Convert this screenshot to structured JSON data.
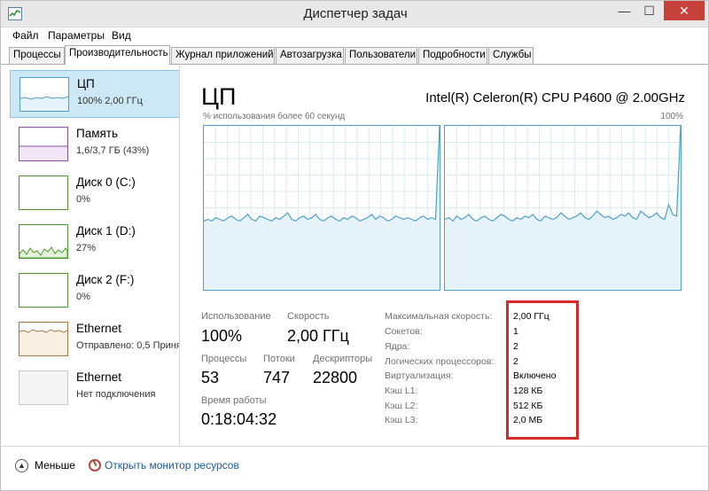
{
  "window": {
    "title": "Диспетчер задач",
    "controls": {
      "minimize": "—",
      "maximize": "☐",
      "close": "✕"
    }
  },
  "menu": [
    "Файл",
    "Параметры",
    "Вид"
  ],
  "tabs": [
    {
      "label": "Процессы",
      "active": false
    },
    {
      "label": "Производительность",
      "active": true
    },
    {
      "label": "Журнал приложений",
      "active": false
    },
    {
      "label": "Автозагрузка",
      "active": false
    },
    {
      "label": "Пользователи",
      "active": false
    },
    {
      "label": "Подробности",
      "active": false
    },
    {
      "label": "Службы",
      "active": false
    }
  ],
  "resources": [
    {
      "name": "ЦП",
      "detail": "100% 2,00 ГГц",
      "selected": true
    },
    {
      "name": "Память",
      "detail": "1,6/3,7 ГБ (43%)"
    },
    {
      "name": "Диск 0 (C:)",
      "detail": "0%"
    },
    {
      "name": "Диск 1 (D:)",
      "detail": "27%"
    },
    {
      "name": "Диск 2 (F:)",
      "detail": "0%"
    },
    {
      "name": "Ethernet",
      "detail": "Отправлено: 0,5 Приня"
    },
    {
      "name": "Ethernet",
      "detail": "Нет подключения"
    }
  ],
  "cpu": {
    "title": "ЦП",
    "model": "Intel(R) Celeron(R) CPU P4600 @ 2.00GHz",
    "graph_label": "% использования более 60 секунд",
    "graph_max": "100%",
    "stats": {
      "usage_label": "Использование",
      "usage_value": "100%",
      "speed_label": "Скорость",
      "speed_value": "2,00 ГГц",
      "processes_label": "Процессы",
      "processes_value": "53",
      "threads_label": "Потоки",
      "threads_value": "747",
      "handles_label": "Дескрипторы",
      "handles_value": "22800",
      "uptime_label": "Время работы",
      "uptime_value": "0:18:04:32"
    },
    "specs": [
      {
        "label": "Максимальная скорость:",
        "value": "2,00 ГГц"
      },
      {
        "label": "Сокетов:",
        "value": "1"
      },
      {
        "label": "Ядра:",
        "value": "2"
      },
      {
        "label": "Логических процессоров:",
        "value": "2"
      },
      {
        "label": "Виртуализация:",
        "value": "Включено"
      },
      {
        "label": "Кэш L1:",
        "value": "128 КБ"
      },
      {
        "label": "Кэш L2:",
        "value": "512 КБ"
      },
      {
        "label": "Кэш L3:",
        "value": "2,0 МБ"
      }
    ]
  },
  "footer": {
    "fewer_details": "Меньше",
    "open_monitor": "Открыть монитор ресурсов"
  },
  "colors": {
    "accent": "#4f9fc9",
    "graph_fill": "#e6f2f9",
    "graph_grid": "#d9ebf5",
    "highlight": "#d42a2a",
    "memory": "#8b4fa3",
    "disk": "#4c9a2a",
    "ethernet": "#a8743a"
  },
  "chart_data": {
    "type": "area",
    "graph_label": "% использования более 60 секунд",
    "ylim": [
      0,
      100
    ],
    "y_max_label": "100%",
    "grid": true,
    "series": [
      {
        "values": [
          42,
          43,
          42,
          44,
          43,
          42,
          44,
          45,
          43,
          42,
          44,
          46,
          43,
          42,
          45,
          44,
          43,
          42,
          44,
          43,
          45,
          47,
          43,
          42,
          44,
          45,
          43,
          44,
          46,
          43,
          42,
          44,
          45,
          43,
          42,
          44,
          43,
          45,
          44,
          42,
          43,
          44,
          46,
          43,
          45,
          44,
          42,
          43,
          45,
          44,
          43,
          44,
          43,
          42,
          44,
          45,
          43,
          44,
          43,
          100
        ]
      },
      {
        "values": [
          43,
          44,
          42,
          45,
          43,
          44,
          46,
          43,
          42,
          44,
          45,
          43,
          42,
          44,
          46,
          45,
          43,
          42,
          44,
          43,
          45,
          44,
          46,
          43,
          42,
          45,
          44,
          43,
          44,
          47,
          45,
          43,
          44,
          45,
          47,
          44,
          43,
          45,
          48,
          46,
          44,
          45,
          43,
          44,
          46,
          45,
          47,
          44,
          43,
          48,
          46,
          44,
          45,
          47,
          44,
          43,
          52,
          46,
          45,
          100
        ]
      }
    ]
  }
}
